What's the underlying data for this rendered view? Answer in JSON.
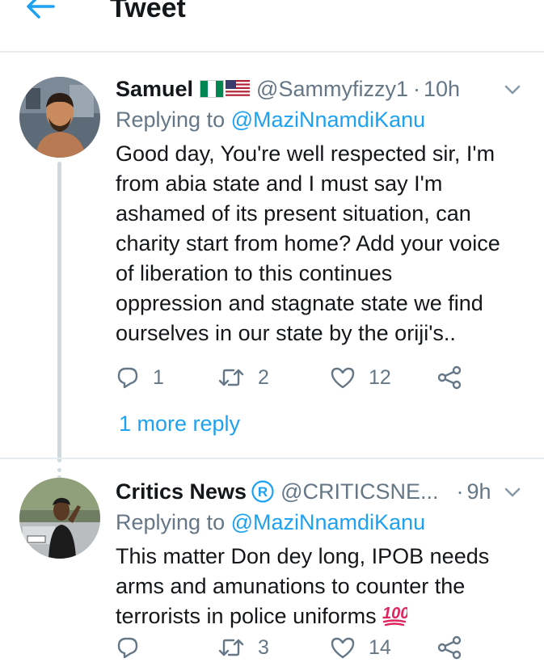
{
  "header": {
    "title": "Tweet",
    "back_icon": "arrow-left-icon",
    "accent_color": "#1da1f2"
  },
  "tweets": [
    {
      "display_name": "Samuel",
      "flags": [
        "flag-nigeria-icon",
        "flag-usa-icon"
      ],
      "handle": "@Sammyfizzy1",
      "separator": "·",
      "time": "10h",
      "replying_prefix": "Replying to",
      "replying_to": "@MaziNnamdiKanu",
      "text_lines": [
        "Good day, You're well respected sir, I'm",
        "from abia state and I must say I'm",
        "ashamed of its present situation, can",
        "charity start from home? Add your voice",
        "of liberation to this continues",
        "oppression and stagnate state we find",
        "ourselves  in our state by the oriji's.."
      ],
      "reply_count": "1",
      "retweet_count": "2",
      "like_count": "12",
      "more_replies": "1 more reply"
    },
    {
      "display_name": "Critics News",
      "badge_letter": "R",
      "handle": "@CRITICSNE...",
      "separator": "·",
      "time": "9h",
      "replying_prefix": "Replying to",
      "replying_to": "@MaziNnamdiKanu",
      "text_lines": [
        "This matter Don dey long, IPOB needs",
        "arms and amunations to counter the",
        "terrorists in police uniforms"
      ],
      "emoji": "hundred-points-icon",
      "reply_count": "",
      "retweet_count": "3",
      "like_count": "14"
    }
  ],
  "colors": {
    "text_primary": "#14171a",
    "text_secondary": "#657786",
    "link": "#1da1f2",
    "divider": "#e6ecf0",
    "thread_line": "#cfd9de"
  }
}
